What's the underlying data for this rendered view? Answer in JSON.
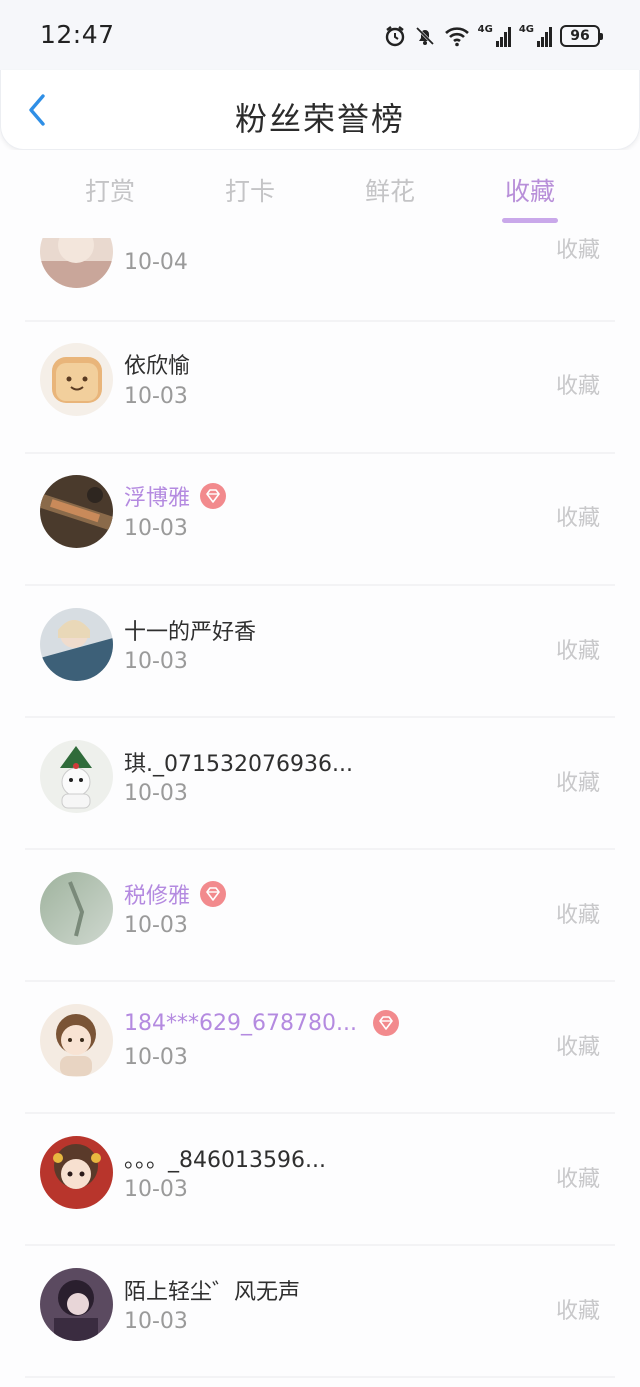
{
  "status_bar": {
    "time": "12:47",
    "network_1": "4G",
    "network_2": "4G",
    "battery": "96"
  },
  "header": {
    "title": "粉丝荣誉榜",
    "back_icon": "chevron-left-icon",
    "accent_color": "#2f8fe6"
  },
  "tabs": [
    {
      "label": "打赏",
      "active": false
    },
    {
      "label": "打卡",
      "active": false
    },
    {
      "label": "鲜花",
      "active": false
    },
    {
      "label": "收藏",
      "active": true
    }
  ],
  "fans": [
    {
      "name": "",
      "date": "10-04",
      "action": "收藏",
      "vip": false,
      "avatar": "avatar-bread",
      "partial": true
    },
    {
      "name": "依欣愉",
      "date": "10-03",
      "action": "收藏",
      "vip": false,
      "avatar": "avatar-toast"
    },
    {
      "name": "浮博雅",
      "date": "10-03",
      "action": "收藏",
      "vip": true,
      "avatar": "avatar-gadget"
    },
    {
      "name": "十一的严好香",
      "date": "10-03",
      "action": "收藏",
      "vip": false,
      "avatar": "avatar-girl"
    },
    {
      "name": "琪._071532076936...",
      "date": "10-03",
      "action": "收藏",
      "vip": false,
      "avatar": "avatar-snowman"
    },
    {
      "name": "税修雅",
      "date": "10-03",
      "action": "收藏",
      "vip": true,
      "avatar": "avatar-green"
    },
    {
      "name": "184***629_678780...",
      "date": "10-03",
      "action": "收藏",
      "vip": true,
      "avatar": "avatar-cartoon"
    },
    {
      "name": "。。。_846013596...",
      "date": "10-03",
      "action": "收藏",
      "vip": false,
      "avatar": "avatar-redgirl"
    },
    {
      "name": "陌上轻尘゛风无声",
      "date": "10-03",
      "action": "收藏",
      "vip": false,
      "avatar": "avatar-dark"
    }
  ],
  "colors": {
    "vip_name": "#b48ae0",
    "badge": "#f28a8d",
    "tab_active": "#b88fd9",
    "tab_inactive": "#c4c4c6"
  }
}
